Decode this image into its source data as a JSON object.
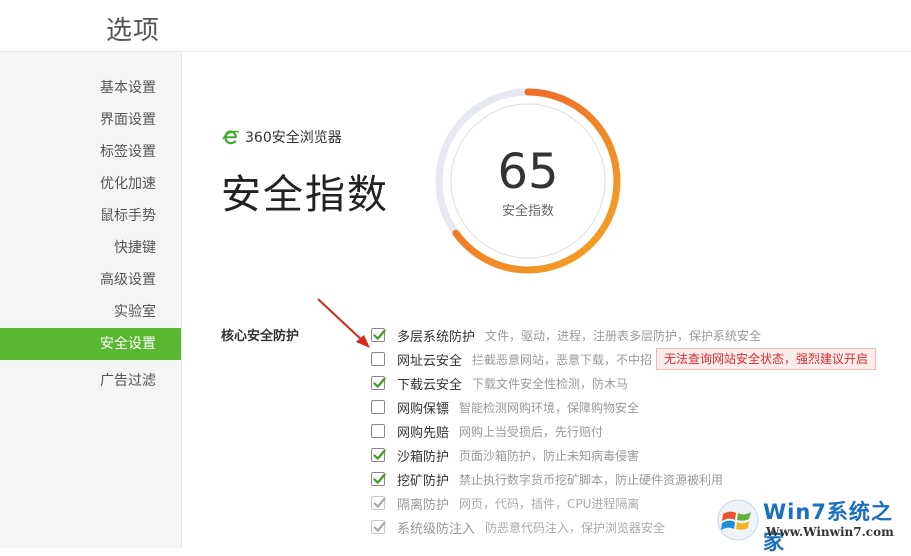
{
  "header": {
    "title": "选项"
  },
  "sidebar": {
    "items": [
      {
        "label": "基本设置",
        "active": false
      },
      {
        "label": "界面设置",
        "active": false
      },
      {
        "label": "标签设置",
        "active": false
      },
      {
        "label": "优化加速",
        "active": false
      },
      {
        "label": "鼠标手势",
        "active": false
      },
      {
        "label": "快捷键",
        "active": false
      },
      {
        "label": "高级设置",
        "active": false
      },
      {
        "label": "实验室",
        "active": false
      },
      {
        "label": "安全设置",
        "active": true
      },
      {
        "label": "广告过滤",
        "active": false
      }
    ]
  },
  "main": {
    "brand": "360安全浏览器",
    "title": "安全指数",
    "gauge": {
      "score": "65",
      "label": "安全指数",
      "progress": 0.65
    },
    "section_label": "核心安全防护",
    "options": [
      {
        "name": "多层系统防护",
        "desc": "文件，驱动，进程，注册表多层防护，保护系统安全",
        "checked": true,
        "disabled": false
      },
      {
        "name": "网址云安全",
        "desc": "拦截恶意网站，恶意下载，不中招",
        "checked": false,
        "disabled": false
      },
      {
        "name": "下载云安全",
        "desc": "下载文件安全性检测，防木马",
        "checked": true,
        "disabled": false
      },
      {
        "name": "网购保镖",
        "desc": "智能检测网购环境，保障购物安全",
        "checked": false,
        "disabled": false
      },
      {
        "name": "网购先赔",
        "desc": "网购上当受损后，先行赔付",
        "checked": false,
        "disabled": false
      },
      {
        "name": "沙箱防护",
        "desc": "页面沙箱防护，防止未知病毒侵害",
        "checked": true,
        "disabled": false
      },
      {
        "name": "挖矿防护",
        "desc": "禁止执行数字货币挖矿脚本，防止硬件资源被利用",
        "checked": true,
        "disabled": false
      },
      {
        "name": "隔离防护",
        "desc": "网页，代码，插件，CPU进程隔离",
        "checked": true,
        "disabled": true
      },
      {
        "name": "系统级防注入",
        "desc": "防恶意代码注入，保护浏览器安全",
        "checked": true,
        "disabled": true
      }
    ],
    "warning": "无法查询网站安全状态，强烈建议开启"
  },
  "watermark": {
    "title": "Win7系统之家",
    "url": "Www.Winwin7.com"
  },
  "colors": {
    "accent": "#59b82f",
    "gauge_start": "#f5a623",
    "gauge_end": "#ec5a2a",
    "warning": "#d62d2d"
  }
}
